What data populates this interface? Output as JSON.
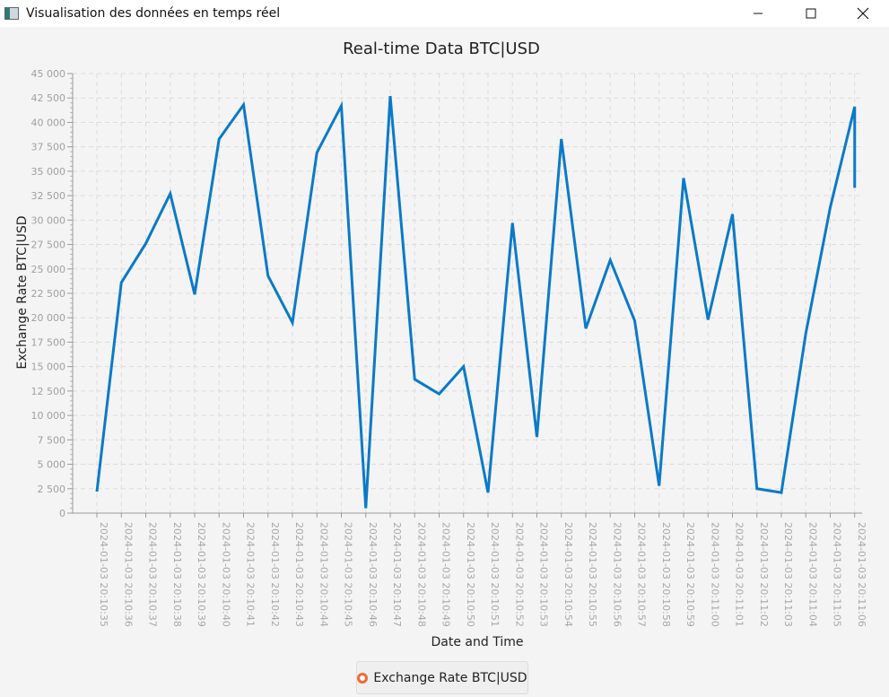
{
  "window": {
    "title": "Visualisation des données en temps réel",
    "icon": "app-window-icon",
    "controls": [
      "minimize-icon",
      "maximize-icon",
      "close-icon"
    ]
  },
  "chart_data": {
    "type": "line",
    "title": "Real-time Data BTC|USD",
    "xlabel": "Date and Time",
    "ylabel": "Exchange Rate BTC|USD",
    "ylim": [
      0,
      45000
    ],
    "y_ticks": [
      "0",
      "2 500",
      "5 000",
      "7 500",
      "10 000",
      "12 500",
      "15 000",
      "17 500",
      "20 000",
      "22 500",
      "25 000",
      "27 500",
      "30 000",
      "32 500",
      "35 000",
      "37 500",
      "40 000",
      "42 500",
      "45 000"
    ],
    "categories": [
      "2024-01-03 20:10:35",
      "2024-01-03 20:10:36",
      "2024-01-03 20:10:37",
      "2024-01-03 20:10:38",
      "2024-01-03 20:10:39",
      "2024-01-03 20:10:40",
      "2024-01-03 20:10:41",
      "2024-01-03 20:10:42",
      "2024-01-03 20:10:43",
      "2024-01-03 20:10:44",
      "2024-01-03 20:10:45",
      "2024-01-03 20:10:46",
      "2024-01-03 20:10:47",
      "2024-01-03 20:10:48",
      "2024-01-03 20:10:49",
      "2024-01-03 20:10:50",
      "2024-01-03 20:10:51",
      "2024-01-03 20:10:52",
      "2024-01-03 20:10:53",
      "2024-01-03 20:10:54",
      "2024-01-03 20:10:55",
      "2024-01-03 20:10:56",
      "2024-01-03 20:10:57",
      "2024-01-03 20:10:58",
      "2024-01-03 20:10:59",
      "2024-01-03 20:11:00",
      "2024-01-03 20:11:01",
      "2024-01-03 20:11:02",
      "2024-01-03 20:11:03",
      "2024-01-03 20:11:04",
      "2024-01-03 20:11:05",
      "2024-01-03 20:11:06"
    ],
    "series": [
      {
        "name": "Exchange Rate BTC|USD",
        "color": "#0a7ac8",
        "values": [
          2200,
          23600,
          27600,
          32700,
          22400,
          38300,
          41800,
          24300,
          19500,
          36900,
          41700,
          500,
          42700,
          13700,
          12200,
          15000,
          2100,
          29700,
          7800,
          38300,
          18900,
          25900,
          19700,
          2800,
          34300,
          19800,
          30600,
          2500,
          2100,
          18400,
          31300,
          41600
        ],
        "final_extra_value": 33300
      }
    ],
    "legend": {
      "position": "bottom-center",
      "symbol_color": "#f06a33"
    },
    "grid": true
  }
}
